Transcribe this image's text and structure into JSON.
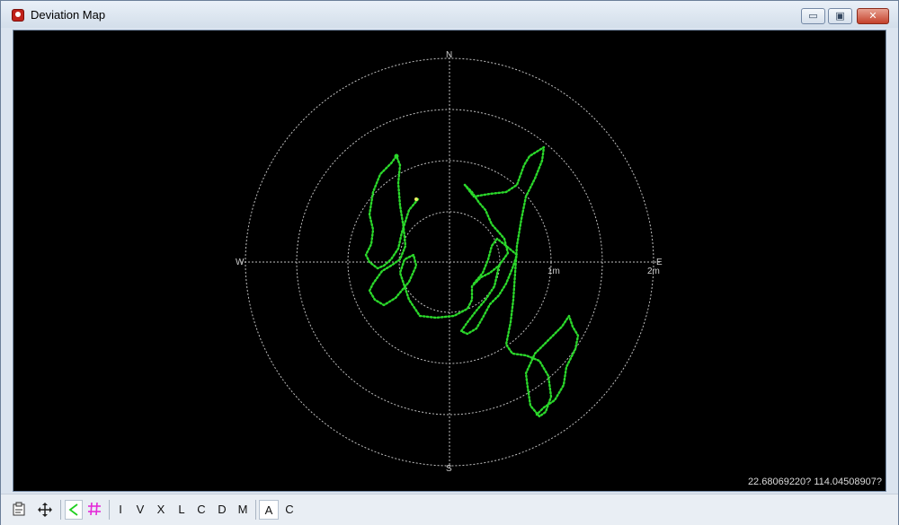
{
  "window": {
    "title": "Deviation Map"
  },
  "controls": {
    "minimize": "▭",
    "maximize": "▣",
    "close": "✕"
  },
  "map": {
    "compass": {
      "north": "N",
      "south": "S",
      "east": "E",
      "west": "W"
    },
    "rings": {
      "r1": "1m",
      "r2": "2m"
    },
    "coordinates": "22.68069220? 114.04508907?",
    "track_color": "#2bd82b",
    "grid_color": "#bfbfbf",
    "marker_color": "#e8f060"
  },
  "toolbar": {
    "tools": [
      "I",
      "V",
      "X",
      "L",
      "C",
      "D",
      "M"
    ],
    "modes": [
      "A",
      "C"
    ]
  }
}
